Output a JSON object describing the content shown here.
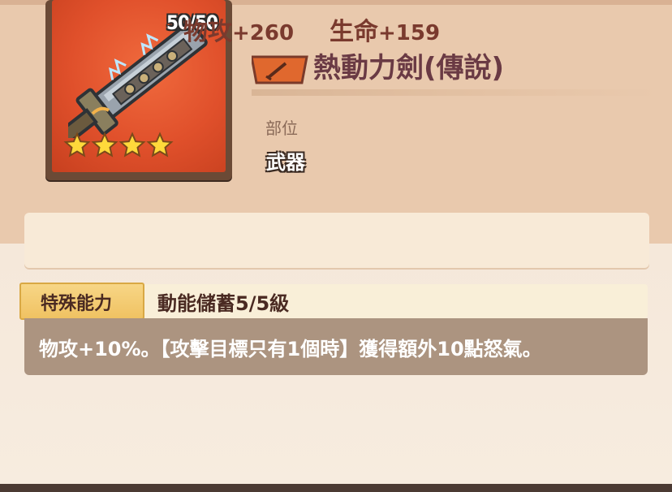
{
  "item": {
    "durability": "50/50",
    "stars": 4,
    "icon": "sword-icon",
    "title": "熱動力劍(傳說)",
    "type_icon": "sword-badge-icon",
    "slot_label": "部位",
    "slot_value": "武器"
  },
  "stats": {
    "atk_label": "物攻",
    "atk_value": "+260",
    "hp_label": "生命",
    "hp_value": "+159"
  },
  "ability": {
    "tag": "特殊能力",
    "name": "動能儲蓄5/5級",
    "description": "物攻+10%。【攻擊目標只有1個時】獲得額外10點怒氣。"
  },
  "colors": {
    "card_background": "#e0502b",
    "title": "#6a3a44",
    "stat_text": "#7a3a2e",
    "ability_tag": "#f0c262",
    "ability_desc_box": "#ac9480"
  }
}
